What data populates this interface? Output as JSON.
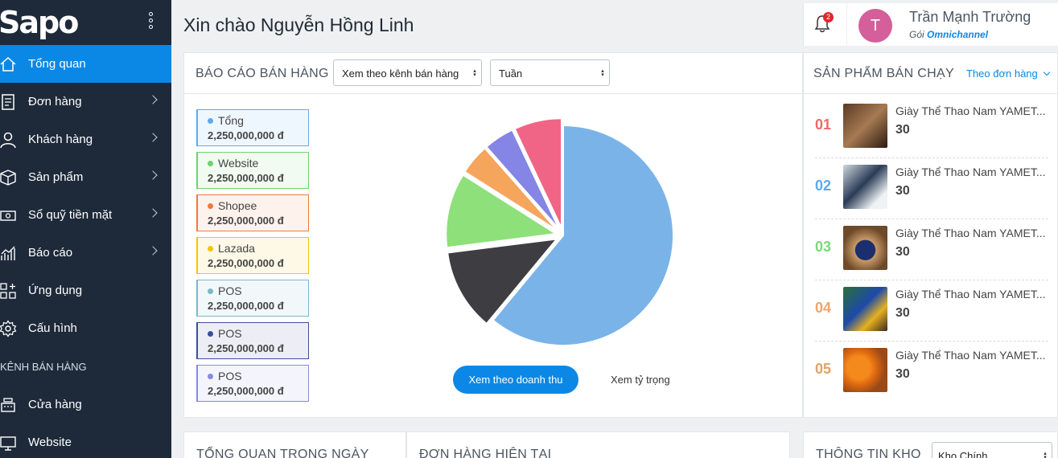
{
  "logo": "Sapo",
  "sidebar": {
    "items": [
      {
        "label": "Tổng quan"
      },
      {
        "label": "Đơn hàng"
      },
      {
        "label": "Khách hàng"
      },
      {
        "label": "Sản phẩm"
      },
      {
        "label": "Sổ quỹ tiền mặt"
      },
      {
        "label": "Báo cáo"
      },
      {
        "label": "Ứng dụng"
      },
      {
        "label": "Cấu hình"
      }
    ],
    "channel_section": "KÊNH BÁN HÀNG",
    "channels": [
      {
        "label": "Cửa hàng"
      },
      {
        "label": "Website"
      }
    ]
  },
  "header": {
    "greeting": "Xin chào Nguyễn Hồng Linh",
    "notification_count": "2",
    "user_initial": "T",
    "user_name": "Trần Mạnh Trường",
    "plan_prefix": "Gói",
    "plan_name": "Omnichannel"
  },
  "sales_report": {
    "title": "BÁO CÁO BÁN HÀNG",
    "view_select": "Xem theo kênh bán hàng",
    "period_select": "Tuần",
    "legend": [
      {
        "name": "Tổng",
        "amount": "2,250,000,000 đ",
        "color": "#5aabf0"
      },
      {
        "name": "Website",
        "amount": "2,250,000,000 đ",
        "color": "#6ed36e"
      },
      {
        "name": "Shopee",
        "amount": "2,250,000,000 đ",
        "color": "#f07a3c"
      },
      {
        "name": "Lazada",
        "amount": "2,250,000,000 đ",
        "color": "#f5c400"
      },
      {
        "name": "POS",
        "amount": "2,250,000,000 đ",
        "color": "#7ab8c9"
      },
      {
        "name": "POS",
        "amount": "2,250,000,000 đ",
        "color": "#3b4f99"
      },
      {
        "name": "POS",
        "amount": "2,250,000,000 đ",
        "color": "#8888e8"
      }
    ],
    "btn_revenue": "Xem theo doanh thu",
    "btn_ratio": "Xem tỷ trọng"
  },
  "chart_data": {
    "type": "pie",
    "slices": [
      {
        "value": 61,
        "color": "#7ab3e8"
      },
      {
        "value": 12,
        "color": "#3d3d42"
      },
      {
        "value": 11,
        "color": "#8ee07a"
      },
      {
        "value": 4.5,
        "color": "#f5a55c"
      },
      {
        "value": 4.5,
        "color": "#8585e6"
      },
      {
        "value": 7,
        "color": "#f06585"
      }
    ]
  },
  "best_sellers": {
    "title": "SẢN PHẨM BÁN CHẠY",
    "filter": "Theo đơn hàng",
    "items": [
      {
        "rank": "01",
        "name": "Giày Thể Thao Nam YAMET...",
        "qty": "30",
        "rank_color": "#f0686a"
      },
      {
        "rank": "02",
        "name": "Giày Thể Thao Nam YAMET...",
        "qty": "30",
        "rank_color": "#5aabf0"
      },
      {
        "rank": "03",
        "name": "Giày Thể Thao Nam YAMET...",
        "qty": "30",
        "rank_color": "#7cd67c"
      },
      {
        "rank": "04",
        "name": "Giày Thể Thao Nam YAMET...",
        "qty": "30",
        "rank_color": "#f0a46a"
      },
      {
        "rank": "05",
        "name": "Giày Thể Thao Nam YAMET...",
        "qty": "30",
        "rank_color": "#e0a36a"
      }
    ]
  },
  "bottom": {
    "today_title": "TỔNG QUAN TRONG NGÀY",
    "orders_title": "ĐƠN HÀNG HIỆN TẠI",
    "stock_title": "THÔNG TIN KHO",
    "stock_select": "Kho Chính"
  }
}
